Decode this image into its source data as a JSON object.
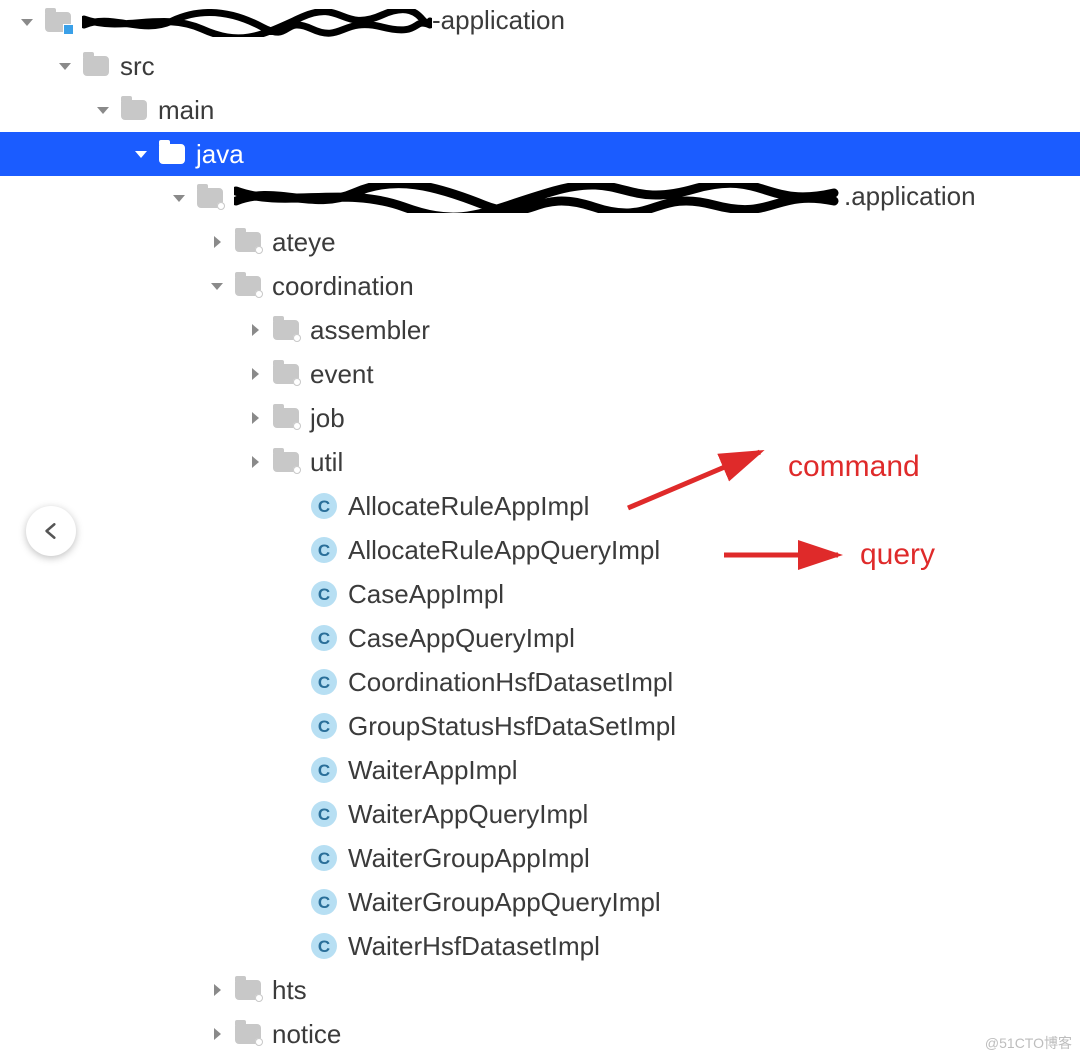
{
  "tree": {
    "root_suffix": "-application",
    "src": "src",
    "main": "main",
    "java": "java",
    "pkg_suffix": ".application",
    "ateye": "ateye",
    "coordination": "coordination",
    "assembler": "assembler",
    "event": "event",
    "job": "job",
    "util": "util",
    "hts": "hts",
    "notice": "notice",
    "classes": [
      "AllocateRuleAppImpl",
      "AllocateRuleAppQueryImpl",
      "CaseAppImpl",
      "CaseAppQueryImpl",
      "CoordinationHsfDatasetImpl",
      "GroupStatusHsfDataSetImpl",
      "WaiterAppImpl",
      "WaiterAppQueryImpl",
      "WaiterGroupAppImpl",
      "WaiterGroupAppQueryImpl",
      "WaiterHsfDatasetImpl"
    ]
  },
  "annotations": {
    "command": "command",
    "query": "query"
  },
  "class_glyph": "C",
  "watermark": "@51CTO博客"
}
